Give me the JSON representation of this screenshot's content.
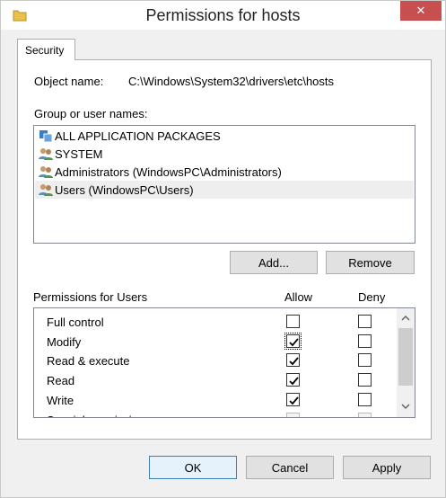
{
  "window": {
    "title": "Permissions for hosts",
    "close_glyph": "✕"
  },
  "tab": {
    "label": "Security"
  },
  "object": {
    "label": "Object name:",
    "value": "C:\\Windows\\System32\\drivers\\etc\\hosts"
  },
  "groups": {
    "label": "Group or user names:",
    "items": [
      {
        "name": "ALL APPLICATION PACKAGES",
        "icon": "app-packages-icon"
      },
      {
        "name": "SYSTEM",
        "icon": "users-group-icon"
      },
      {
        "name": "Administrators (WindowsPC\\Administrators)",
        "icon": "users-group-icon"
      },
      {
        "name": "Users (WindowsPC\\Users)",
        "icon": "users-group-icon",
        "selected": true
      }
    ]
  },
  "buttons": {
    "add": "Add...",
    "remove": "Remove",
    "ok": "OK",
    "cancel": "Cancel",
    "apply": "Apply"
  },
  "permissions": {
    "label": "Permissions for Users",
    "allow_header": "Allow",
    "deny_header": "Deny",
    "rows": [
      {
        "name": "Full control",
        "allow": false,
        "deny": false
      },
      {
        "name": "Modify",
        "allow": true,
        "deny": false
      },
      {
        "name": "Read & execute",
        "allow": true,
        "deny": false
      },
      {
        "name": "Read",
        "allow": true,
        "deny": false
      },
      {
        "name": "Write",
        "allow": true,
        "deny": false
      },
      {
        "name": "Special permissions",
        "allow": false,
        "deny": false
      }
    ]
  },
  "colors": {
    "close_button": "#c74f4f",
    "selection": "#eeeeee",
    "default_button_border": "#3c7fb1"
  }
}
